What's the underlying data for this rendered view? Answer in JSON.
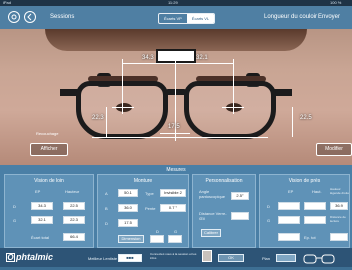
{
  "status": {
    "device": "iPad",
    "time": "11:29",
    "battery": "100 %"
  },
  "topbar": {
    "title": "Sessions",
    "tabs": [
      {
        "label": "Écarts VP"
      },
      {
        "label": "Écarts VL",
        "active": true
      }
    ],
    "right_label": "Longueur du couloir",
    "send_label": "Envoyer"
  },
  "photo": {
    "measures": {
      "top_left": "34.3",
      "top_right": "32.1",
      "left_height": "22.3",
      "right_height": "22.5",
      "bridge": "17.5"
    },
    "left_buttons": {
      "small": "Recouchage",
      "afficher": "Afficher"
    },
    "right_button": "Modifier"
  },
  "section_title": "Mesures",
  "vision_loin": {
    "title": "Vision de loin",
    "col_ep": "EP",
    "col_hauteur": "Hauteur",
    "row_right": "D",
    "row_left": "G",
    "ep_right": "34.3",
    "h_right": "22.5",
    "ep_left": "32.1",
    "h_left": "22.3",
    "ecart_total_label": "Écart total",
    "ecart_total": "66.4"
  },
  "monture": {
    "title": "Monture",
    "a_label": "A",
    "a_value": "50.1",
    "b_label": "B",
    "b_value": "36.0",
    "d_label": "D",
    "d_value": "17.5",
    "type_label": "Type",
    "type_value": "Invisible 2",
    "pente_label": "Pente",
    "pente_value": "0.7 °",
    "dim_label": "Dimension",
    "col_d": "D",
    "col_g": "G"
  },
  "personnalisation": {
    "title": "Personnalisation",
    "angle_label": "Angle pantoscopique",
    "angle_value": "2.5°",
    "distance_label": "Distance Verre-Œil",
    "calibrer": "Calibrer"
  },
  "vision_pres": {
    "title": "Vision de près",
    "col_ep": "EP",
    "col_hauteur": "Haut.",
    "col_extra": "Hauteur légende droite",
    "row_right": "D",
    "row_left": "G",
    "extra_value": "36.9",
    "distance_label": "Distance de lecture",
    "ep_tot": "Ep. tot"
  },
  "footer": {
    "logo": "phtalmic",
    "meilleur_label": "Meilleur Lentiste",
    "info_text": "Connectez-vous à la session et les infos",
    "ok": "OK",
    "plan": "Plan"
  }
}
